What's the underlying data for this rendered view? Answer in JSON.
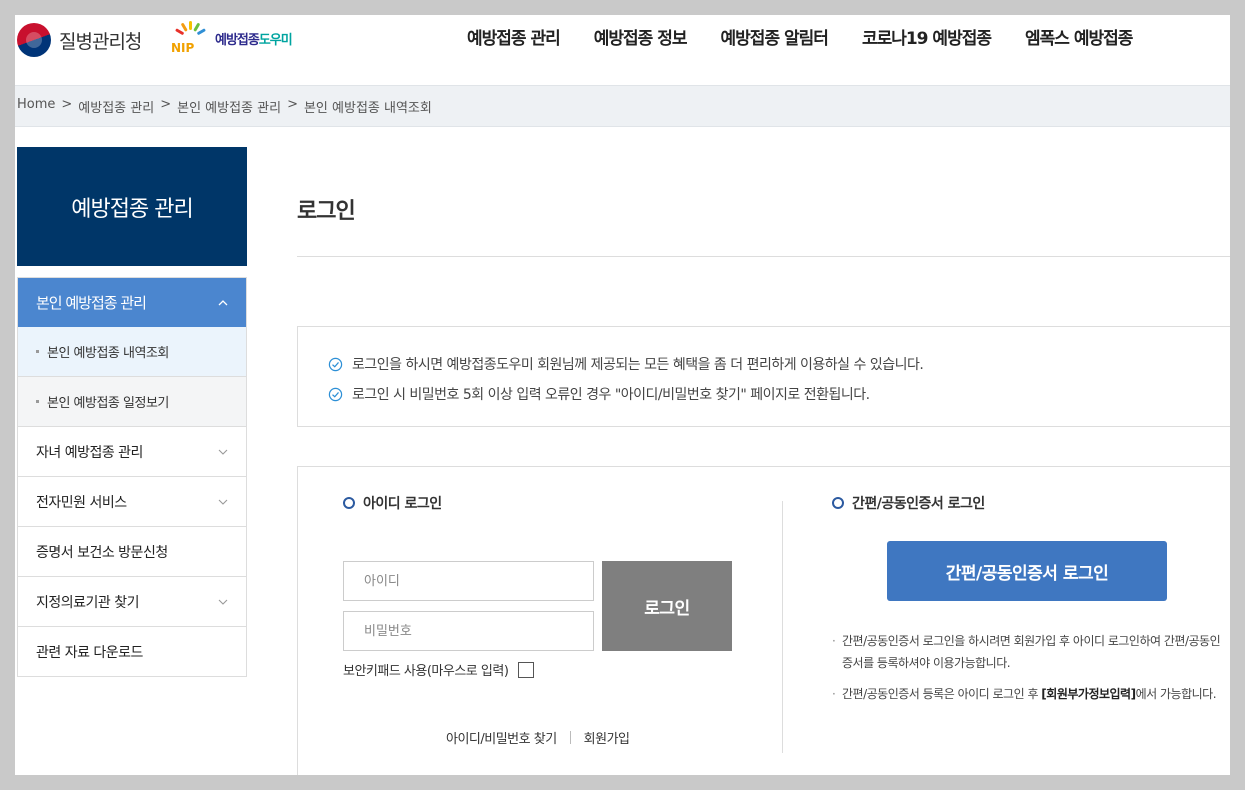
{
  "header": {
    "org_name": "질병관리청",
    "nip_logo_text": "NIP",
    "nip_name_part1": "예방접종",
    "nip_name_part2": "도우미",
    "gnb": [
      "예방접종 관리",
      "예방접종 정보",
      "예방접종 알림터",
      "코로나19 예방접종",
      "엠폭스 예방접종"
    ]
  },
  "breadcrumb": {
    "separator": ">",
    "items": [
      "Home",
      "예방접종 관리",
      "본인 예방접종 관리",
      "본인 예방접종 내역조회"
    ]
  },
  "sidebar": {
    "title": "예방접종 관리",
    "active_group": "본인 예방접종 관리",
    "sub_items": [
      "본인 예방접종 내역조회",
      "본인 예방접종 일정보기"
    ],
    "items": [
      {
        "label": "자녀 예방접종 관리",
        "has_chevron": true
      },
      {
        "label": "전자민원 서비스",
        "has_chevron": true
      },
      {
        "label": "증명서 보건소 방문신청",
        "has_chevron": false
      },
      {
        "label": "지정의료기관 찾기",
        "has_chevron": true
      },
      {
        "label": "관련 자료 다운로드",
        "has_chevron": false
      }
    ]
  },
  "main": {
    "title": "로그인",
    "notices": [
      "로그인을 하시면 예방접종도우미 회원님께 제공되는 모든 혜택을 좀 더 편리하게 이용하실 수 있습니다.",
      "로그인 시 비밀번호 5회 이상 입력 오류인 경우 \"아이디/비밀번호 찾기\" 페이지로 전환됩니다."
    ],
    "id_login": {
      "title": "아이디 로그인",
      "id_placeholder": "아이디",
      "pw_placeholder": "비밀번호",
      "login_button": "로그인",
      "keypad_label": "보안키패드 사용(마우스로 입력)",
      "find_link": "아이디/비밀번호 찾기",
      "join_link": "회원가입"
    },
    "cert_login": {
      "title": "간편/공동인증서 로그인",
      "button": "간편/공동인증서 로그인",
      "note1": "간편/공동인증서 로그인을 하시려면 회원가입 후 아이디 로그인하여 간편/공동인증서를 등록하셔야 이용가능합니다.",
      "note2_pre": "간편/공동인증서 등록은 아이디 로그인 후 ",
      "note2_bold": "[회원부가정보입력]",
      "note2_post": "에서 가능합니다."
    }
  },
  "colors": {
    "side_title_bg": "#003668",
    "side_active_bg": "#4b86cf",
    "cert_button": "#3f77c1",
    "login_button": "#7f7f7f",
    "crumb_bar": "#eef1f4"
  }
}
